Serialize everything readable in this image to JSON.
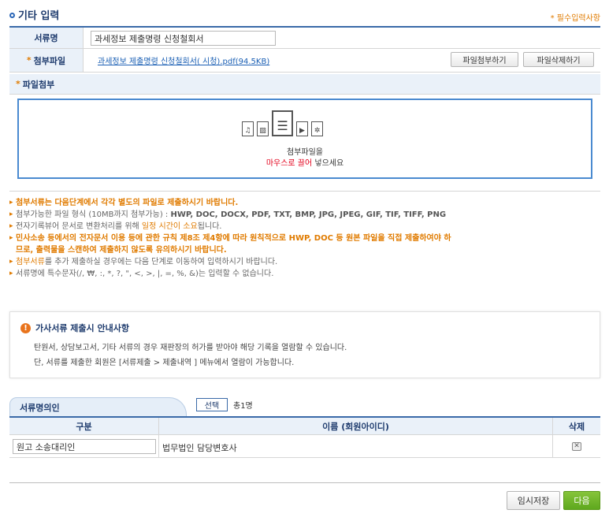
{
  "header": {
    "title": "기타 입력",
    "required_note": "* 필수입력사항"
  },
  "form": {
    "doc_name_label": "서류명",
    "doc_name_value": "과세정보 제출명령 신청철회서",
    "attachment_label": "첨부파일",
    "attachment_link": "과세정보 제출명령 신청철회서(      시청).pdf(94.5KB)",
    "attach_button": "파일첨부하기",
    "delete_button": "파일삭제하기",
    "upload_section_label": "파일첨부"
  },
  "dropzone": {
    "line1": "첨부파일을",
    "line2_red": "마우스로 끌어",
    "line2_rest": " 넣으세요",
    "icons": [
      "audio-file-icon",
      "image-file-icon",
      "document-file-icon",
      "video-file-icon",
      "settings-file-icon"
    ]
  },
  "notes": {
    "n1": "첨부서류는 다음단계에서 각각 별도의 파일로 제출하시기 바랍니다.",
    "n2_prefix": "첨부가능한 파일 형식 (10MB까지 첨부가능) : ",
    "n2_formats": "HWP, DOC, DOCX, PDF, TXT, BMP, JPG, JPEG, GIF, TIF, TIFF, PNG",
    "n3_prefix": "전자기록뷰어 문서로 변환처리를 위해 ",
    "n3_highlight": "일정 시간이 소요",
    "n3_suffix": "됩니다.",
    "n4_line1": "민사소송 등에서의 전자문서 이용 등에 관한 규칙 제8조 제4항에 따라 원칙적으로 HWP, DOC 등 원본 파일을 직접 제출하여야 하",
    "n4_line2": "므로, 출력물을 스캔하여 제출하지 않도록 유의하시기 바랍니다.",
    "n5_highlight": "첨부서류",
    "n5_suffix": "를 추가 제출하실 경우에는 다음 단계로 이동하여 입력하시기 바랍니다.",
    "n6": "서류명에 특수문자(/, ₩, :, *, ?, \", <, >, |, =, %, &)는 입력할 수 없습니다."
  },
  "notice": {
    "title": "가사서류 제출시 안내사항",
    "line1": "탄원서, 상담보고서, 기타 서류의 경우 재판장의 허가를 받아야 해당 기록을 열람할 수 있습니다.",
    "line2": "단, 서류를 제출한 회원은 [서류제출 > 제출내역 ] 메뉴에서 열람이 가능합니다."
  },
  "party": {
    "tab_label": "서류명의인",
    "select_button": "선택",
    "total": "총1명",
    "columns": [
      "구분",
      "이름 (회원아이디)",
      "삭제"
    ],
    "rows": [
      {
        "role": "원고 소송대리인",
        "name": "법무법인        담당변호사"
      }
    ]
  },
  "actions": {
    "temp_save": "임시저장",
    "next": "다음"
  },
  "colors": {
    "primary_navy": "#1f3c6e",
    "accent_orange": "#e07b00",
    "highlight_red": "#e3001b",
    "next_green": "#6bb52a"
  }
}
